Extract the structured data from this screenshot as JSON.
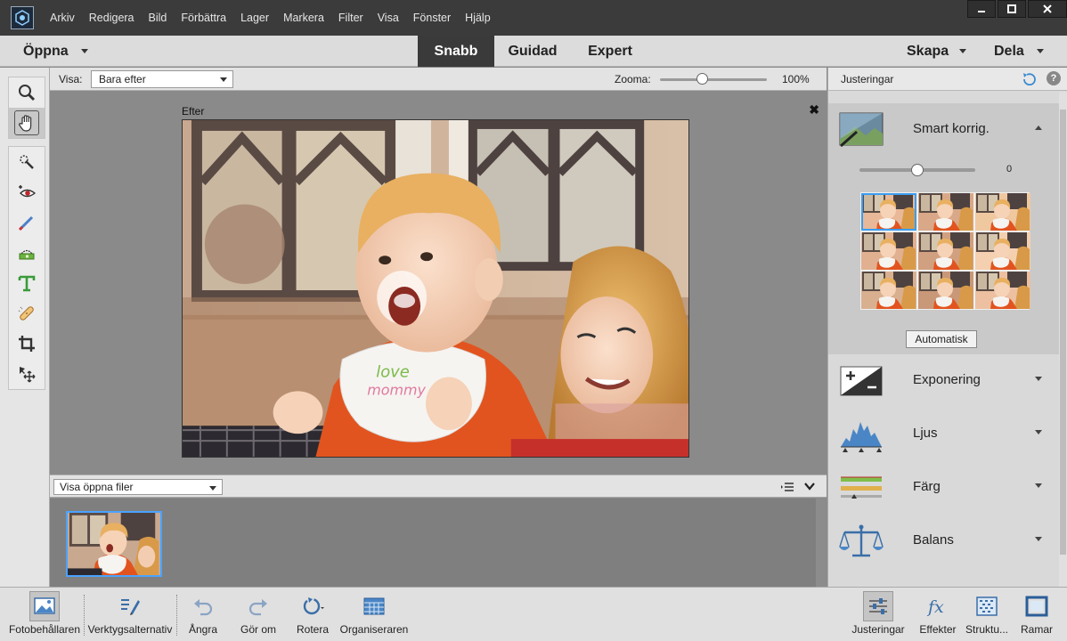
{
  "menubar": {
    "items": [
      "Arkiv",
      "Redigera",
      "Bild",
      "Förbättra",
      "Lager",
      "Markera",
      "Filter",
      "Visa",
      "Fönster",
      "Hjälp"
    ]
  },
  "modebar": {
    "open_label": "Öppna",
    "tabs": [
      "Snabb",
      "Guidad",
      "Expert"
    ],
    "active_tab": "Snabb",
    "create_label": "Skapa",
    "share_label": "Dela"
  },
  "view_bar": {
    "view_label": "Visa:",
    "view_value": "Bara efter",
    "zoom_label": "Zooma:",
    "zoom_value": "100%",
    "zoom_level_percent": 100
  },
  "canvas": {
    "after_label": "Efter",
    "close_glyph": "✖"
  },
  "bin": {
    "files_value": "Visa öppna filer"
  },
  "panel": {
    "title": "Justeringar",
    "help_glyph": "?",
    "smart_fix": {
      "label": "Smart korrig.",
      "slider_value": "0",
      "auto_label": "Automatisk"
    },
    "adjustments": [
      {
        "label": "Exponering",
        "icon": "exposure-icon"
      },
      {
        "label": "Ljus",
        "icon": "levels-icon"
      },
      {
        "label": "Färg",
        "icon": "color-icon"
      },
      {
        "label": "Balans",
        "icon": "balance-icon"
      }
    ]
  },
  "taskbar": {
    "photo_bin": "Fotobehållaren",
    "tool_options": "Verktygsalternativ",
    "undo": "Ångra",
    "redo": "Gör om",
    "rotate": "Rotera",
    "organizer": "Organiseraren",
    "adjustments": "Justeringar",
    "effects": "Effekter",
    "textures": "Struktu...",
    "frames": "Ramar"
  },
  "colors": {
    "menubar_bg": "#3b3b3b",
    "active_tab_bg": "#3a3a3a",
    "selection_blue": "#3a9cf0"
  }
}
